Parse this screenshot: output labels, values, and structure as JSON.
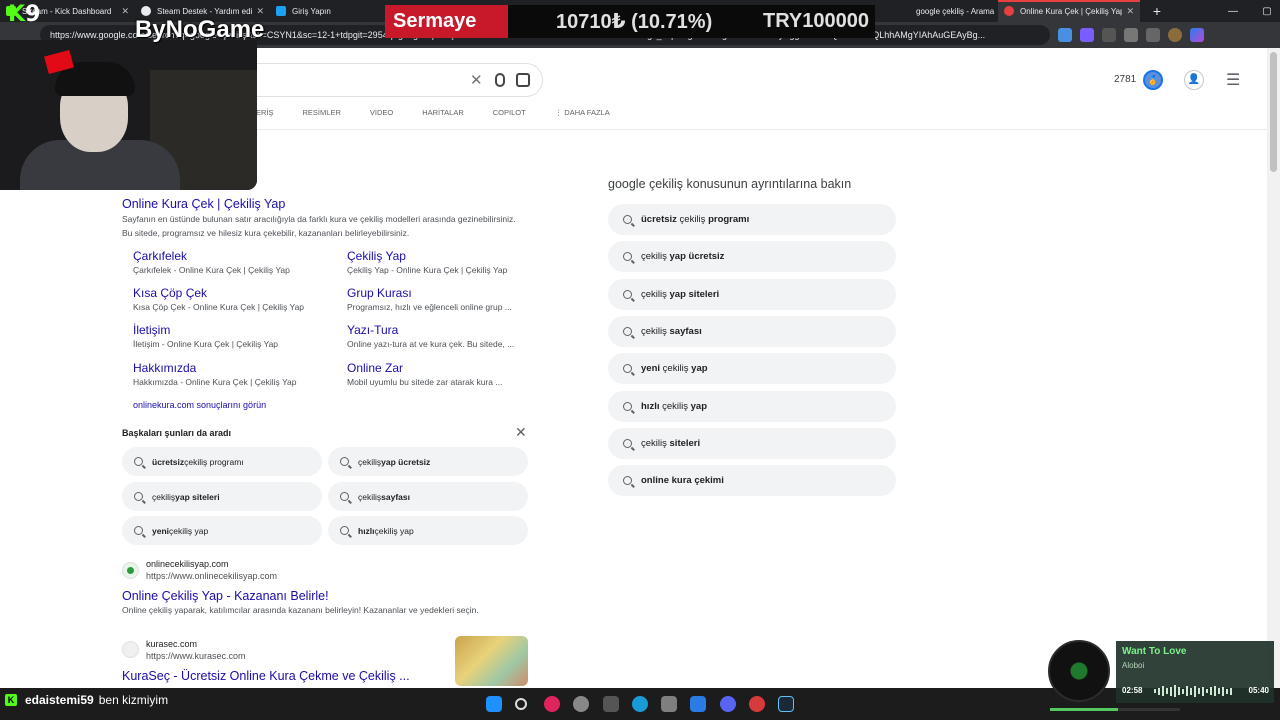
{
  "browser": {
    "tabs": [
      {
        "title": "Stream - Kick Dashboard",
        "color": "#53fc18"
      },
      {
        "title": "Steam Destek - Yardım edin",
        "color": "#e8eaed"
      },
      {
        "title": "Giriş Yapın",
        "color": "#1da1f2"
      },
      {
        "title": "",
        "color": "#202124"
      },
      {
        "title": "google çekiliş - Arama",
        "color": "#4285f4"
      },
      {
        "title": "Online Kura Çek | Çekiliş Yap",
        "color": "#e84040"
      }
    ],
    "url": "https://www.google.com/search?q=google+çekiliş&sk=CSYN1&sc=12-1+tdpgit=2954q=google+çekiliş&cvid=b07221dc2bd345cab0d0e0b77821050d&gs_lcrp=EgRzGdlkg1hABAASEAyBgg AEAAYQDIGCAEQLhhAMgYIAhAuGEAyBg..."
  },
  "overlay": {
    "sermaye_label": "Sermaye",
    "sermaye_change": "10710₺ (10.71%)",
    "sermaye_total": "TRY100000",
    "brand": "ByNoGame",
    "k9_k": "K",
    "k9_n": "9"
  },
  "google": {
    "count": "2781",
    "tabs": [
      "ERİŞ",
      "RESİMLER",
      "VİDEO",
      "HARİTALAR",
      "COPILOT",
      "⋮ DAHA FAZLA"
    ]
  },
  "result1": {
    "title": "Online Kura Çek | Çekiliş Yap",
    "snippet": "Sayfanın en üstünde bulunan satır aracılığıyla da farklı kura ve çekiliş modelleri arasında gezinebilirsiniz. Bu sitede, programsız ve hilesiz kura çekebilir, kazananları belirleyebilirsiniz.",
    "sitelinks": [
      {
        "title": "Çarkıfelek",
        "desc": "Çarkıfelek - Online Kura Çek | Çekiliş Yap"
      },
      {
        "title": "Çekiliş Yap",
        "desc": "Çekiliş Yap - Online Kura Çek | Çekiliş Yap"
      },
      {
        "title": "Kısa Çöp Çek",
        "desc": "Kısa Çöp Çek - Online Kura Çek | Çekiliş Yap"
      },
      {
        "title": "Grup Kurası",
        "desc": "Programsız, hızlı ve eğlenceli online grup ..."
      },
      {
        "title": "İletişim",
        "desc": "İletişim - Online Kura Çek | Çekiliş Yap"
      },
      {
        "title": "Yazı-Tura",
        "desc": "Online yazı-tura at ve kura çek. Bu sitede, ..."
      },
      {
        "title": "Hakkımızda",
        "desc": "Hakkımızda - Online Kura Çek | Çekiliş Yap"
      },
      {
        "title": "Online Zar",
        "desc": "Mobil uyumlu bu sitede zar atarak kura ..."
      }
    ],
    "more": "onlinekura.com sonuçlarını görün"
  },
  "people_also": {
    "title": "Başkaları şunları da aradı",
    "close": "✕",
    "chips": [
      {
        "bold": "ücretsiz",
        "rest": " çekiliş programı",
        "bold_first": true
      },
      {
        "bold": "yap ücretsiz",
        "rest": "çekiliş ",
        "bold_first": false
      },
      {
        "bold": "yap siteleri",
        "rest": "çekiliş ",
        "bold_first": false
      },
      {
        "bold": "sayfası",
        "rest": "çekiliş ",
        "bold_first": false
      },
      {
        "bold": "yeni",
        "rest": " çekiliş yap",
        "bold_first": true
      },
      {
        "bold": "hızlı",
        "rest": " çekiliş yap",
        "bold_first": true
      }
    ]
  },
  "result2": {
    "site": "onlinecekilisyap.com",
    "url": "https://www.onlinecekilisyap.com",
    "title": "Online Çekiliş Yap - Kazananı Belirle!",
    "snippet": "Online çekiliş yaparak, katılımcılar arasında kazananı belirleyin! Kazananlar ve yedekleri seçin."
  },
  "result3": {
    "site": "kurasec.com",
    "url": "https://www.kurasec.com",
    "title": "KuraSeç - Ücretsiz Online Kura Çekme ve Çekiliş ..."
  },
  "right_panel": {
    "title": "google çekiliş konusunun ayrıntılarına bakın",
    "items": [
      {
        "pre": "",
        "bold": "ücretsiz",
        "post": " çekiliş ",
        "bold2": "programı"
      },
      {
        "pre": "çekiliş ",
        "bold": "yap ücretsiz",
        "post": "",
        "bold2": ""
      },
      {
        "pre": "çekiliş ",
        "bold": "yap siteleri",
        "post": "",
        "bold2": ""
      },
      {
        "pre": "çekiliş ",
        "bold": "sayfası",
        "post": "",
        "bold2": ""
      },
      {
        "pre": "",
        "bold": "yeni",
        "post": " çekiliş ",
        "bold2": "yap"
      },
      {
        "pre": "",
        "bold": "hızlı",
        "post": " çekiliş ",
        "bold2": "yap"
      },
      {
        "pre": "çekiliş ",
        "bold": "siteleri",
        "post": "",
        "bold2": ""
      },
      {
        "pre": "",
        "bold": "online kura çekimi",
        "post": "",
        "bold2": ""
      }
    ]
  },
  "chat": {
    "user": "edaistemi59",
    "message": "ben kizmiyim"
  },
  "music": {
    "song": "Want To Love",
    "artist": "Aloboi",
    "elapsed": "02:58",
    "duration": "05:40",
    "progress": 0.52
  }
}
